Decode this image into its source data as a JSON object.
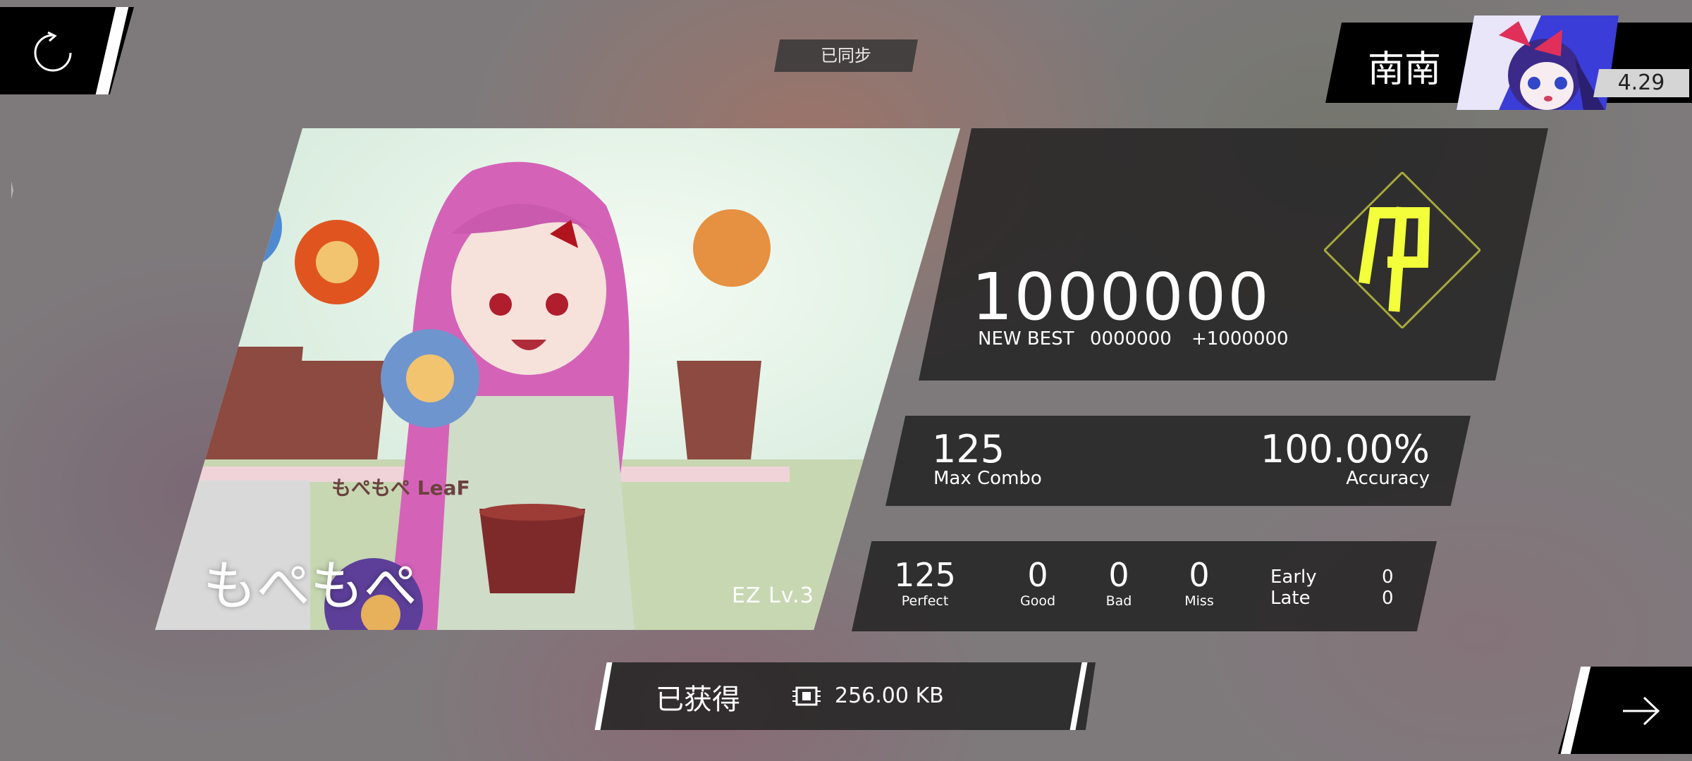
{
  "sync_status": "已同步",
  "player": {
    "name": "南南",
    "rks": "4.29"
  },
  "song": {
    "title": "もぺもぺ",
    "level": "EZ  Lv.3",
    "art_caption": "もぺもぺ  LeaF"
  },
  "score": {
    "value": "1000000",
    "new_best_label": "NEW BEST",
    "previous_best": "0000000",
    "delta": "+1000000",
    "grade": "φ"
  },
  "combo": {
    "max_combo": "125",
    "max_combo_label": "Max Combo",
    "accuracy": "100.00%",
    "accuracy_label": "Accuracy"
  },
  "judgements": [
    {
      "value": "125",
      "label": "Perfect"
    },
    {
      "value": "0",
      "label": "Good"
    },
    {
      "value": "0",
      "label": "Bad"
    },
    {
      "value": "0",
      "label": "Miss"
    }
  ],
  "timing": {
    "early_label": "Early",
    "early_value": "0",
    "late_label": "Late",
    "late_value": "0"
  },
  "reward": {
    "label": "已获得",
    "size": "256.00 KB"
  },
  "icons": {
    "retry": "retry-icon",
    "next": "arrow-right-icon",
    "data": "chip-icon"
  },
  "colors": {
    "grade_glow": "#f2ff3a",
    "panel": "#262424"
  }
}
